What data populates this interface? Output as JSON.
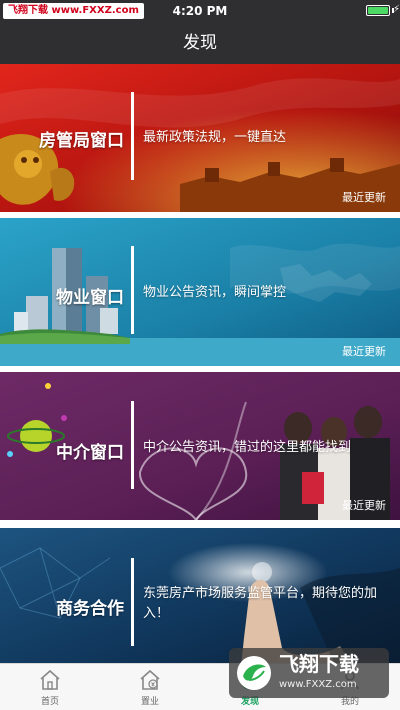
{
  "status_bar": {
    "watermark": "飞翔下载 www.FXXZ.com",
    "time": "4:20 PM"
  },
  "nav": {
    "title": "发现"
  },
  "banners": [
    {
      "title": "房管局窗口",
      "desc": "最新政策法规，一键直达",
      "update": "最近更新",
      "icon": "great-wall-lion-image",
      "color": "#b3140f"
    },
    {
      "title": "物业窗口",
      "desc": "物业公告资讯，瞬间掌控",
      "update": "最近更新",
      "icon": "city-skyline-image",
      "color": "#1a7fa6"
    },
    {
      "title": "中介窗口",
      "desc": "中介公告资讯，错过的这里都能找到",
      "update": "最近更新",
      "icon": "planet-heart-image",
      "color": "#5b1f55"
    },
    {
      "title": "商务合作",
      "desc": "东莞房产市场服务监管平台，期待您的加入！",
      "update": "",
      "icon": "hand-touch-image",
      "color": "#0f3458"
    }
  ],
  "tabs": [
    {
      "label": "首页",
      "icon": "home-icon",
      "active": false
    },
    {
      "label": "置业",
      "icon": "property-icon",
      "active": false
    },
    {
      "label": "发现",
      "icon": "discover-icon",
      "active": true
    },
    {
      "label": "我的",
      "icon": "profile-icon",
      "active": false
    }
  ],
  "watermark_br": {
    "name": "飞翔下载",
    "url": "www.FXXZ.com"
  },
  "colors": {
    "nav_bg": "#2f2f31",
    "active_tab": "#19a15f"
  }
}
